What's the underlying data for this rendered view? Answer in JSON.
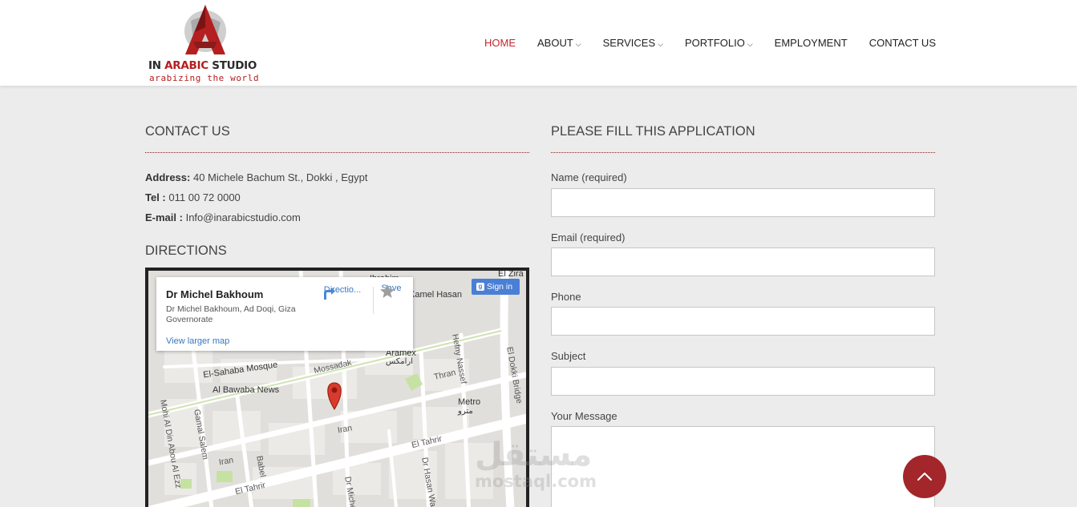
{
  "logo": {
    "brand_prefix": "IN",
    "brand_highlight": "ARABIC",
    "brand_suffix": "STUDIO",
    "tagline": "arabizing the world"
  },
  "nav": {
    "home": "HOME",
    "about": "ABOUT",
    "services": "SERVICES",
    "portfolio": "PORTFOLIO",
    "employment": "EMPLOYMENT",
    "contact": "CONTACT US",
    "caret": "⌵"
  },
  "contact": {
    "title": "CONTACT US",
    "address_label": "Address:",
    "address_value": "40 Michele Bachum St., Dokki , Egypt",
    "tel_label": "Tel :",
    "tel_value": "011 00 72 0000",
    "email_label": "E-mail :",
    "email_value": "Info@inarabicstudio.com"
  },
  "directions": {
    "title": "DIRECTIONS",
    "card_title": "Dr Michel Bakhoum",
    "card_address": "Dr Michel Bakhoum, Ad Doqi, Giza Governorate",
    "directions_label": "Directio...",
    "save_label": "Save",
    "larger_map_label": "View larger map",
    "signin_label": "Sign in",
    "labels": {
      "kamel_hasan": "Kamel Hasan",
      "aramex": "Aramex",
      "aramex_ar": "ارامكس",
      "el_sahaba": "El-Sahaba Mosque",
      "mossadak": "Mossadak",
      "thran": "Thran",
      "al_bawaba": "Al Bawaba News",
      "metro": "Metro",
      "metro_ar": "مترو",
      "hefny": "Hefny Nassef",
      "el_dokki": "El Dokki Bridge",
      "mohi": "Mohi Al Din Abou Al Ezz",
      "gamal": "Gamal Salem",
      "iran": "Iran",
      "iran2": "Iran",
      "babel": "Babel",
      "el_tahrir": "El Tahrir",
      "el_tahrir2": "El Tahrir",
      "hasan": "Dr Hasan Wa",
      "dr_michel": "Dr Michel",
      "ibrahim": "Ibrahim",
      "el_ziraa": "El Zira"
    }
  },
  "application": {
    "title": "PLEASE FILL THIS APPLICATION",
    "name_label": "Name (required)",
    "email_label": "Email (required)",
    "phone_label": "Phone",
    "subject_label": "Subject",
    "message_label": "Your Message"
  },
  "watermark": {
    "arabic": "مستقل",
    "latin": "mostaql.com"
  },
  "colors": {
    "accent": "#c1272d",
    "scroll_button": "#a3262a"
  }
}
